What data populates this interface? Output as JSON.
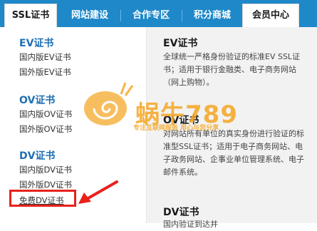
{
  "nav": {
    "tabs": [
      {
        "label": "SSL证书"
      },
      {
        "label": "网站建设"
      },
      {
        "label": "合作专区"
      },
      {
        "label": "积分商城"
      },
      {
        "label": "会员中心"
      }
    ]
  },
  "menu": {
    "categories": [
      {
        "title": "EV证书",
        "items": [
          "国内版EV证书",
          "国外版EV证书"
        ]
      },
      {
        "title": "OV证书",
        "items": [
          "国内版OV证书",
          "国外版OV证书"
        ]
      },
      {
        "title": "DV证书",
        "items": [
          "国内版DV证书",
          "国外版DV证书",
          "免费DV证书"
        ]
      }
    ]
  },
  "details": [
    {
      "title": "EV证书",
      "desc": "全球统一严格身份验证的标准EV SSL证书；适用于银行金融类、电子商务网站（网上购物）。"
    },
    {
      "title": "OV证书",
      "desc": "对网站所有单位的真实身份进行验证的标准型SSL证书；适用于电子商务网站、电子政务网站、企事业单位管理系统、电子邮件系统。"
    },
    {
      "title": "DV证书",
      "desc": "国内验证到达并"
    }
  ],
  "watermark": {
    "brand": "蜗牛789",
    "tagline": "专注互联网服务 用心与您分享"
  },
  "colors": {
    "nav_bg": "#1e88c9",
    "link": "#1e6fb3",
    "highlight": "#e8211c"
  }
}
